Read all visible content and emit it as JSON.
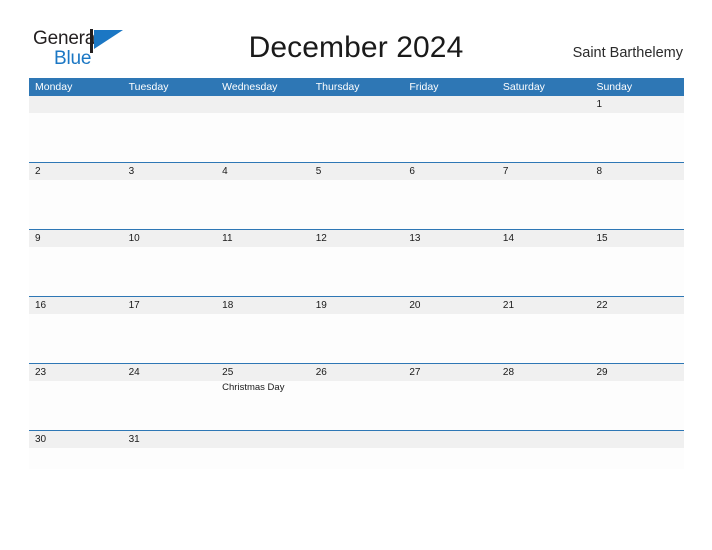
{
  "brand": {
    "name_part1": "General",
    "name_part2": "Blue",
    "flag_icon": "flag-icon",
    "color_dark": "#231f20",
    "color_blue": "#1b77c4"
  },
  "header": {
    "title": "December 2024",
    "location": "Saint Barthelemy"
  },
  "theme": {
    "header_blue": "#2e77b5",
    "date_band_gray": "#f0f0f0",
    "cell_white": "#fdfdfd",
    "text_dark": "#1a1a1a"
  },
  "calendar": {
    "day_headers": [
      "Monday",
      "Tuesday",
      "Wednesday",
      "Thursday",
      "Friday",
      "Saturday",
      "Sunday"
    ],
    "weeks": [
      [
        {
          "date": "",
          "events": []
        },
        {
          "date": "",
          "events": []
        },
        {
          "date": "",
          "events": []
        },
        {
          "date": "",
          "events": []
        },
        {
          "date": "",
          "events": []
        },
        {
          "date": "",
          "events": []
        },
        {
          "date": "1",
          "events": []
        }
      ],
      [
        {
          "date": "2",
          "events": []
        },
        {
          "date": "3",
          "events": []
        },
        {
          "date": "4",
          "events": []
        },
        {
          "date": "5",
          "events": []
        },
        {
          "date": "6",
          "events": []
        },
        {
          "date": "7",
          "events": []
        },
        {
          "date": "8",
          "events": []
        }
      ],
      [
        {
          "date": "9",
          "events": []
        },
        {
          "date": "10",
          "events": []
        },
        {
          "date": "11",
          "events": []
        },
        {
          "date": "12",
          "events": []
        },
        {
          "date": "13",
          "events": []
        },
        {
          "date": "14",
          "events": []
        },
        {
          "date": "15",
          "events": []
        }
      ],
      [
        {
          "date": "16",
          "events": []
        },
        {
          "date": "17",
          "events": []
        },
        {
          "date": "18",
          "events": []
        },
        {
          "date": "19",
          "events": []
        },
        {
          "date": "20",
          "events": []
        },
        {
          "date": "21",
          "events": []
        },
        {
          "date": "22",
          "events": []
        }
      ],
      [
        {
          "date": "23",
          "events": []
        },
        {
          "date": "24",
          "events": []
        },
        {
          "date": "25",
          "events": [
            "Christmas Day"
          ]
        },
        {
          "date": "26",
          "events": []
        },
        {
          "date": "27",
          "events": []
        },
        {
          "date": "28",
          "events": []
        },
        {
          "date": "29",
          "events": []
        }
      ],
      [
        {
          "date": "30",
          "events": []
        },
        {
          "date": "31",
          "events": []
        },
        {
          "date": "",
          "events": []
        },
        {
          "date": "",
          "events": []
        },
        {
          "date": "",
          "events": []
        },
        {
          "date": "",
          "events": []
        },
        {
          "date": "",
          "events": []
        }
      ]
    ]
  }
}
